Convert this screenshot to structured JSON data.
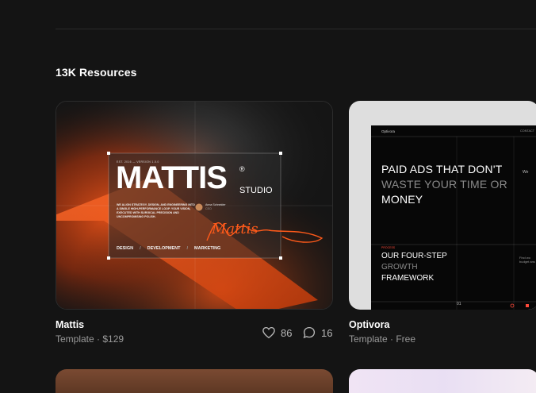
{
  "resources": {
    "count_label": "13K Resources"
  },
  "cards": [
    {
      "title": "Mattis",
      "meta": "Template · $129",
      "likes": "86",
      "comments": "16",
      "preview": {
        "small_header": "EST. 2016 — VERSION 1.0.0",
        "brand": "MATTIS",
        "registered": "®",
        "studio": "STUDIO",
        "tagline": "WE ALIGN STRATEGY, DESIGN, AND ENGINEERING INTO A SINGLE HIGH-PERFORMANCE LOOP. YOUR VISION, EXECUTED WITH SURGICAL PRECISION AND UNCOMPROMISING POLISH.",
        "person_name": "Anna Schneider",
        "person_role": "CEO",
        "signature": "Mattis",
        "nav": [
          "DESIGN",
          "/",
          "DEVELOPMENT",
          "/",
          "MARKETING"
        ]
      }
    },
    {
      "title": "Optivora",
      "meta": "Template · Free",
      "preview": {
        "logo": "Optivora",
        "contact": "CONTACT",
        "headline_1": "PAID ADS THAT DON'T",
        "headline_2": "WASTE YOUR TIME OR",
        "headline_3": "MONEY",
        "side_text": "We",
        "section_label": "PROCESS",
        "sub_1": "OUR FOUR-STEP",
        "sub_2": "GROWTH",
        "sub_3": "FRAMEWORK",
        "side_text_2": "Find wo budget ans",
        "step_num": "01"
      }
    }
  ],
  "colors": {
    "accent": "#ff5a1a",
    "background": "#141414",
    "muted": "#9a9a9a"
  },
  "icons": {
    "likes": "heart-icon",
    "comments": "comment-icon"
  }
}
